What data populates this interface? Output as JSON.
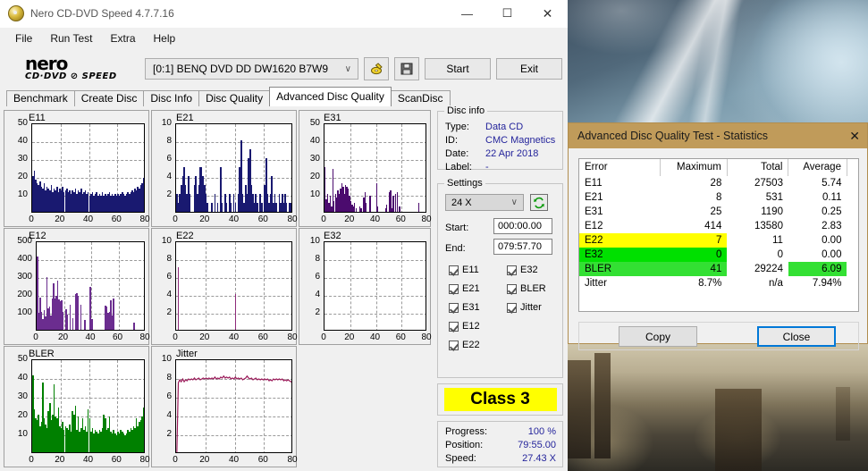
{
  "window": {
    "title": "Nero CD-DVD Speed 4.7.7.16",
    "minimize": "—",
    "maximize": "☐",
    "close": "✕"
  },
  "menu": [
    "File",
    "Run Test",
    "Extra",
    "Help"
  ],
  "logo": {
    "line1": "nero",
    "line2": "CD·DVD ⊘ SPEED"
  },
  "toolbar": {
    "drive": "[0:1]   BENQ DVD DD DW1620 B7W9",
    "caret": "∨",
    "eject_icon": "eject-disc-icon",
    "save_icon": "floppy-save-icon",
    "start": "Start",
    "exit": "Exit"
  },
  "tabs": [
    {
      "label": "Benchmark",
      "active": false
    },
    {
      "label": "Create Disc",
      "active": false
    },
    {
      "label": "Disc Info",
      "active": false
    },
    {
      "label": "Disc Quality",
      "active": false
    },
    {
      "label": "Advanced Disc Quality",
      "active": true
    },
    {
      "label": "ScanDisc",
      "active": false
    }
  ],
  "disc_info": {
    "title": "Disc info",
    "rows": [
      {
        "key": "Type:",
        "value": "Data CD"
      },
      {
        "key": "ID:",
        "value": "CMC Magnetics"
      },
      {
        "key": "Date:",
        "value": "22 Apr 2018"
      },
      {
        "key": "Label:",
        "value": "-"
      }
    ]
  },
  "settings": {
    "title": "Settings",
    "speed": "24 X",
    "caret": "∨",
    "refresh_icon": "refresh-icon",
    "start_label": "Start:",
    "start_value": "000:00.00",
    "end_label": "End:",
    "end_value": "079:57.70",
    "checkboxes_left": [
      "E11",
      "E21",
      "E31",
      "E12",
      "E22"
    ],
    "checkboxes_right": [
      "E32",
      "BLER",
      "Jitter"
    ]
  },
  "class": {
    "label": "Class 3",
    "color": "#ffff00"
  },
  "status": {
    "rows": [
      {
        "key": "Progress:",
        "value": "100 %"
      },
      {
        "key": "Position:",
        "value": "79:55.00"
      },
      {
        "key": "Speed:",
        "value": "27.43 X"
      }
    ]
  },
  "dialog": {
    "title": "Advanced Disc Quality Test - Statistics",
    "close_icon": "✕",
    "headers": [
      "Error",
      "Maximum",
      "Total",
      "Average"
    ],
    "rows": [
      {
        "error": "E11",
        "maximum": "28",
        "total": "27503",
        "average": "5.74",
        "highlight": "none"
      },
      {
        "error": "E21",
        "maximum": "8",
        "total": "531",
        "average": "0.11",
        "highlight": "none"
      },
      {
        "error": "E31",
        "maximum": "25",
        "total": "1190",
        "average": "0.25",
        "highlight": "none"
      },
      {
        "error": "E12",
        "maximum": "414",
        "total": "13580",
        "average": "2.83",
        "highlight": "none"
      },
      {
        "error": "E22",
        "maximum": "7",
        "total": "11",
        "average": "0.00",
        "highlight": "yellow"
      },
      {
        "error": "E32",
        "maximum": "0",
        "total": "0",
        "average": "0.00",
        "highlight": "green"
      },
      {
        "error": "BLER",
        "maximum": "41",
        "total": "29224",
        "average": "6.09",
        "highlight": "greenbler"
      },
      {
        "error": "Jitter",
        "maximum": "8.7%",
        "total": "n/a",
        "average": "7.94%",
        "highlight": "none"
      }
    ],
    "copy": "Copy",
    "close": "Close",
    "colors": {
      "yellow": "#ffff00",
      "green": "#00e000",
      "header_bar": "#c09b5a",
      "focus": "#0078d7"
    }
  },
  "chart_data": [
    {
      "type": "bar",
      "name": "E11",
      "title": "E11",
      "xlabel": "",
      "ylabel": "",
      "xlim": [
        0,
        80
      ],
      "ylim": [
        0,
        50
      ],
      "xticks": [
        0,
        20,
        40,
        60,
        80
      ],
      "yticks": [
        10,
        20,
        30,
        40,
        50
      ],
      "color": "#191970",
      "grid": true,
      "values": [
        20,
        23,
        18,
        16,
        15,
        17,
        14,
        13,
        16,
        12,
        14,
        13,
        12,
        15,
        11,
        13,
        12,
        14,
        11,
        13,
        12,
        14,
        11,
        12,
        13,
        11,
        12,
        10,
        12,
        11,
        13,
        10,
        12,
        11,
        13,
        10,
        11,
        12,
        10,
        11,
        9,
        10,
        11,
        9,
        10,
        11,
        9,
        10,
        9,
        11,
        9,
        10,
        9,
        10,
        11,
        9,
        10,
        9,
        10,
        9,
        10,
        9,
        10,
        11,
        10,
        9,
        10,
        11,
        10,
        11,
        12,
        11,
        13,
        12,
        14,
        13,
        15,
        16,
        19,
        28
      ]
    },
    {
      "type": "bar",
      "name": "E21",
      "title": "E21",
      "xlabel": "",
      "ylabel": "",
      "xlim": [
        0,
        80
      ],
      "ylim": [
        0,
        10
      ],
      "xticks": [
        0,
        20,
        40,
        60,
        80
      ],
      "yticks": [
        2,
        4,
        6,
        8,
        10
      ],
      "color": "#191970",
      "grid": true,
      "values": [
        2,
        1,
        2,
        3,
        4,
        5,
        3,
        2,
        4,
        2,
        0,
        0,
        3,
        4,
        2,
        3,
        5,
        5,
        4,
        3,
        2,
        1,
        0,
        0,
        1,
        0,
        2,
        0,
        1,
        0,
        5,
        1,
        0,
        2,
        1,
        0,
        2,
        1,
        0,
        2,
        1,
        0,
        2,
        5,
        8,
        2,
        1,
        3,
        2,
        6,
        7,
        3,
        2,
        1,
        2,
        1,
        0,
        2,
        1,
        0,
        3,
        6,
        2,
        1,
        2,
        4,
        1,
        2,
        1,
        0,
        2,
        1,
        2,
        1,
        2,
        1,
        0,
        1,
        1,
        0
      ]
    },
    {
      "type": "bar",
      "name": "E31",
      "title": "E31",
      "xlabel": "",
      "ylabel": "",
      "xlim": [
        0,
        80
      ],
      "ylim": [
        0,
        50
      ],
      "xticks": [
        0,
        20,
        40,
        60,
        80
      ],
      "yticks": [
        10,
        20,
        30,
        40,
        50
      ],
      "color": "#4b0b6e",
      "grid": true,
      "values": [
        25,
        7,
        10,
        5,
        9,
        3,
        24,
        6,
        10,
        8,
        12,
        10,
        13,
        16,
        14,
        10,
        15,
        14,
        13,
        9,
        6,
        4,
        3,
        5,
        2,
        0,
        0,
        3,
        2,
        0,
        8,
        11,
        5,
        0,
        0,
        9,
        0,
        0,
        0,
        0,
        16,
        3,
        0,
        0,
        0,
        0,
        0,
        2,
        4,
        0,
        11,
        12,
        2,
        9,
        0,
        10,
        11,
        0,
        3,
        0,
        0,
        0,
        0,
        0,
        0,
        0,
        0,
        0,
        0,
        0,
        0,
        0,
        0,
        5,
        0,
        0,
        0,
        0,
        0,
        0
      ]
    },
    {
      "type": "bar",
      "name": "E12",
      "title": "E12",
      "xlabel": "",
      "ylabel": "",
      "xlim": [
        0,
        80
      ],
      "ylim": [
        0,
        500
      ],
      "xticks": [
        0,
        20,
        40,
        60,
        80
      ],
      "yticks": [
        100,
        200,
        300,
        400,
        500
      ],
      "color": "#6b2d8f",
      "grid": true,
      "values": [
        410,
        95,
        180,
        100,
        60,
        110,
        75,
        295,
        120,
        130,
        80,
        175,
        260,
        175,
        190,
        275,
        170,
        160,
        165,
        100,
        0,
        115,
        85,
        0,
        140,
        0,
        65,
        0,
        200,
        205,
        190,
        0,
        140,
        0,
        0,
        55,
        0,
        0,
        0,
        240,
        60,
        0,
        0,
        0,
        0,
        0,
        0,
        0,
        0,
        0,
        135,
        130,
        95,
        100,
        165,
        80,
        175,
        0,
        0,
        0,
        0,
        0,
        0,
        0,
        0,
        0,
        0,
        0,
        0,
        0,
        0,
        40,
        0,
        0,
        0,
        0,
        0,
        0,
        0,
        0
      ]
    },
    {
      "type": "bar",
      "name": "E22",
      "title": "E22",
      "xlabel": "",
      "ylabel": "",
      "xlim": [
        0,
        80
      ],
      "ylim": [
        0,
        10
      ],
      "xticks": [
        0,
        20,
        40,
        60,
        80
      ],
      "yticks": [
        2,
        4,
        6,
        8,
        10
      ],
      "color": "#8e2a7a",
      "grid": true,
      "values": [
        0,
        7,
        0,
        0,
        0,
        0,
        0,
        0,
        0,
        0,
        0,
        0,
        0,
        0,
        0,
        0,
        0,
        0,
        0,
        0,
        0,
        0,
        0,
        0,
        0,
        0,
        0,
        0,
        0,
        0,
        0,
        0,
        0,
        0,
        0,
        0,
        0,
        0,
        0,
        0,
        4,
        0,
        0,
        0,
        0,
        0,
        0,
        0,
        0,
        0,
        0,
        0,
        0,
        0,
        0,
        0,
        0,
        0,
        0,
        0,
        0,
        0,
        0,
        0,
        0,
        0,
        0,
        0,
        0,
        0,
        0,
        0,
        0,
        0,
        0,
        0,
        0,
        0,
        0,
        0
      ]
    },
    {
      "type": "bar",
      "name": "E32",
      "title": "E32",
      "xlabel": "",
      "ylabel": "",
      "xlim": [
        0,
        80
      ],
      "ylim": [
        0,
        10
      ],
      "xticks": [
        0,
        20,
        40,
        60,
        80
      ],
      "yticks": [
        2,
        4,
        6,
        8,
        10
      ],
      "color": "#8e2a7a",
      "grid": true,
      "values": [
        0,
        0,
        0,
        0,
        0,
        0,
        0,
        0,
        0,
        0,
        0,
        0,
        0,
        0,
        0,
        0,
        0,
        0,
        0,
        0,
        0,
        0,
        0,
        0,
        0,
        0,
        0,
        0,
        0,
        0,
        0,
        0,
        0,
        0,
        0,
        0,
        0,
        0,
        0,
        0,
        0,
        0,
        0,
        0,
        0,
        0,
        0,
        0,
        0,
        0,
        0,
        0,
        0,
        0,
        0,
        0,
        0,
        0,
        0,
        0,
        0,
        0,
        0,
        0,
        0,
        0,
        0,
        0,
        0,
        0,
        0,
        0,
        0,
        0,
        0,
        0,
        0,
        0,
        0,
        0
      ]
    },
    {
      "type": "bar",
      "name": "BLER",
      "title": "BLER",
      "xlabel": "",
      "ylabel": "",
      "xlim": [
        0,
        80
      ],
      "ylim": [
        0,
        50
      ],
      "xticks": [
        0,
        20,
        40,
        60,
        80
      ],
      "yticks": [
        10,
        20,
        30,
        40,
        50
      ],
      "color": "#008000",
      "grid": true,
      "values": [
        41,
        23,
        18,
        17,
        20,
        14,
        16,
        37,
        18,
        15,
        13,
        22,
        26,
        17,
        20,
        36,
        19,
        18,
        24,
        14,
        13,
        16,
        12,
        14,
        13,
        12,
        15,
        11,
        22,
        20,
        25,
        12,
        19,
        11,
        13,
        18,
        12,
        14,
        11,
        23,
        18,
        11,
        13,
        10,
        12,
        11,
        10,
        12,
        11,
        13,
        20,
        18,
        12,
        13,
        19,
        11,
        10,
        12,
        10,
        9,
        11,
        10,
        12,
        11,
        10,
        9,
        10,
        12,
        11,
        13,
        12,
        14,
        13,
        18,
        14,
        16,
        17,
        19,
        24,
        30
      ]
    },
    {
      "type": "line",
      "name": "Jitter",
      "title": "Jitter",
      "xlabel": "",
      "ylabel": "",
      "xlim": [
        0,
        80
      ],
      "ylim": [
        0,
        10
      ],
      "xticks": [
        0,
        20,
        40,
        60,
        80
      ],
      "yticks": [
        2,
        4,
        6,
        8,
        10
      ],
      "color": "#9b1b5a",
      "grid": true,
      "values": [
        0,
        7.6,
        7.9,
        7.7,
        8.0,
        7.7,
        7.9,
        7.8,
        8.0,
        7.9,
        8.0,
        7.9,
        8.1,
        7.9,
        8.0,
        8.1,
        7.9,
        8.0,
        8.1,
        8.0,
        8.1,
        8.0,
        8.1,
        8.0,
        8.1,
        8.0,
        8.2,
        8.0,
        8.1,
        8.0,
        8.2,
        8.1,
        8.3,
        8.1,
        8.2,
        8.1,
        8.2,
        8.0,
        8.1,
        8.0,
        8.2,
        8.0,
        8.1,
        8.0,
        8.1,
        7.9,
        8.0,
        8.1,
        8.3,
        8.1,
        8.0,
        8.1,
        7.9,
        8.0,
        8.1,
        7.9,
        8.0,
        7.9,
        8.0,
        7.9,
        8.0,
        7.9,
        8.0,
        7.8,
        7.9,
        7.8,
        8.0,
        7.9,
        8.0,
        7.9,
        8.0,
        7.9,
        8.0,
        7.8,
        7.9,
        7.8,
        7.9,
        7.8,
        7.7,
        7.6
      ]
    }
  ]
}
